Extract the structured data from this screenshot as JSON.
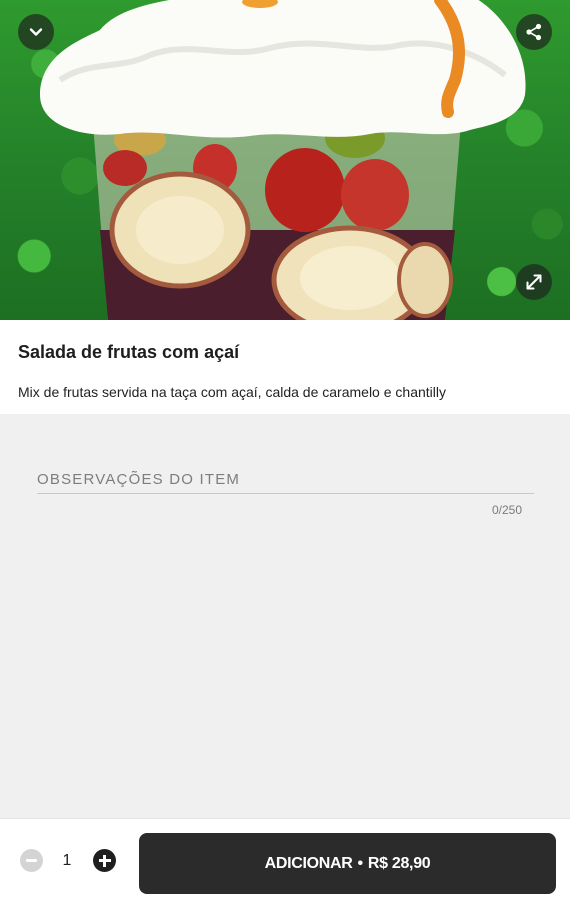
{
  "product": {
    "title": "Salada de frutas com açaí",
    "description": "Mix de frutas servida na taça com açaí, calda de caramelo e chantilly",
    "image_alt": "Salada de frutas com açaí"
  },
  "hero": {
    "collapse_icon": "chevron-down-icon",
    "share_icon": "share-icon",
    "expand_icon": "expand-icon"
  },
  "notes": {
    "placeholder": "OBSERVAÇÕES DO ITEM",
    "value": "",
    "counter": "0/250"
  },
  "footer": {
    "quantity": "1",
    "add_label": "ADICIONAR",
    "separator": "•",
    "price": "R$ 28,90",
    "minus_icon": "minus-circle-icon",
    "plus_icon": "plus-circle-icon"
  },
  "colors": {
    "button_dark": "#2b2b2b",
    "notes_background": "#f0f0f0",
    "disabled_minus": "#d4d4d4"
  }
}
